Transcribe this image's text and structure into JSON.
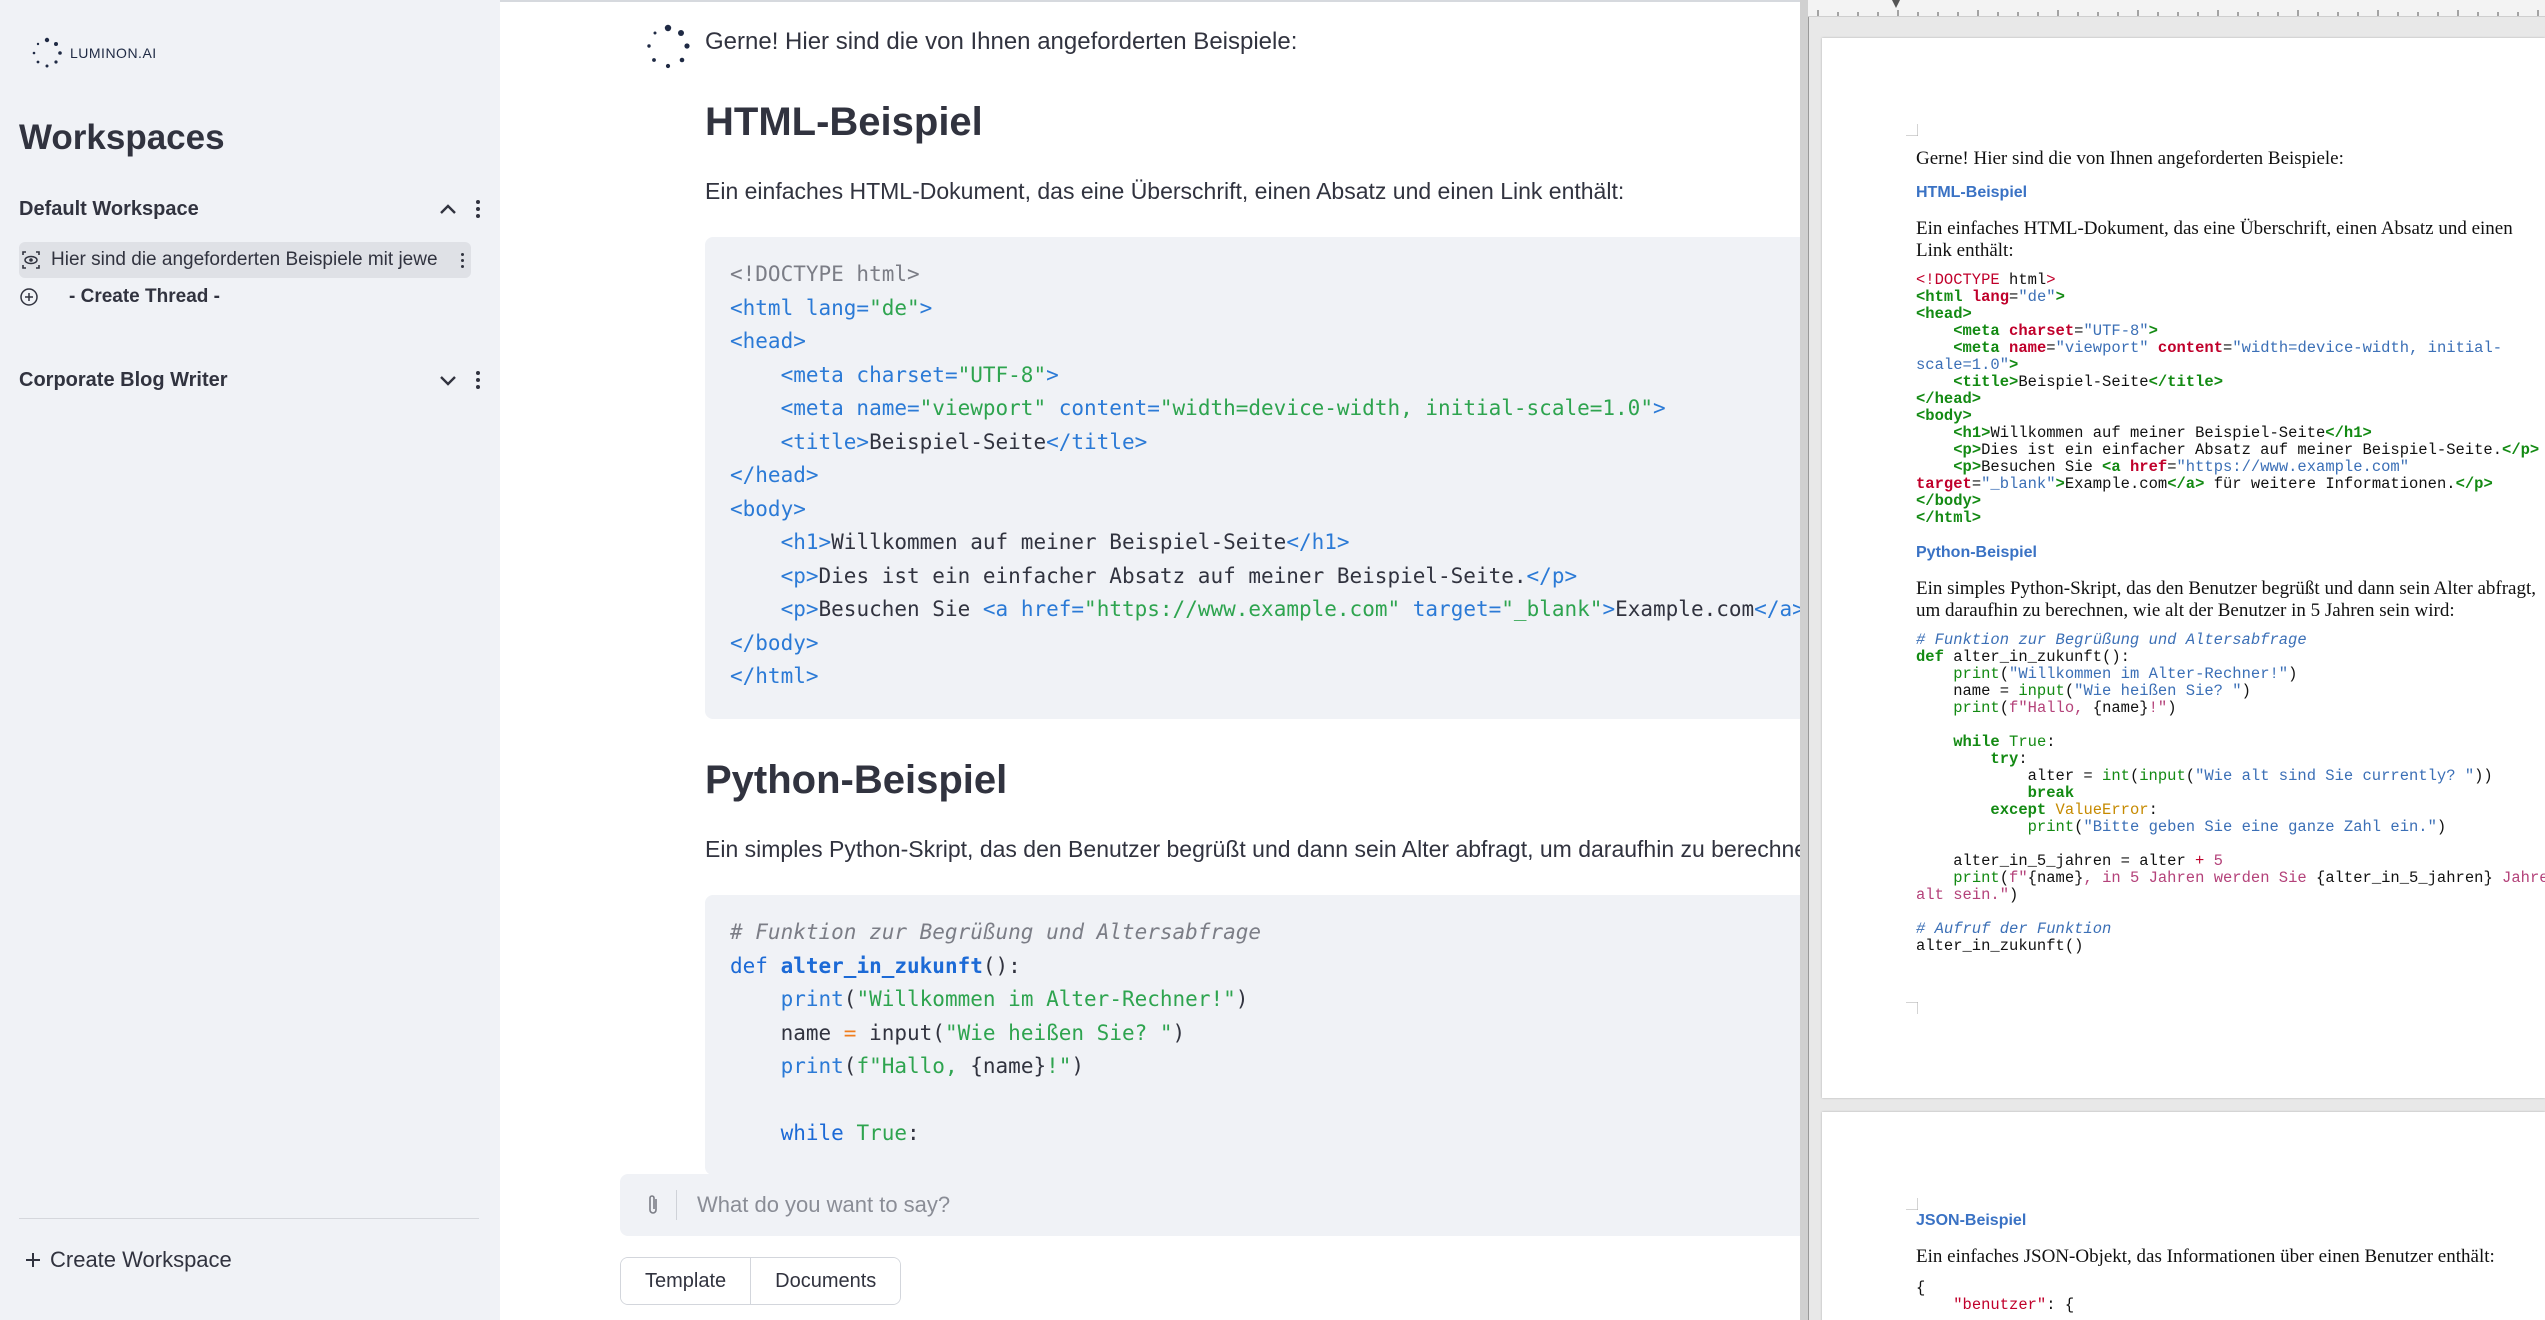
{
  "sidebar": {
    "logo_text": "LUMINON.AI",
    "title": "Workspaces",
    "workspaces": [
      {
        "name": "Default Workspace",
        "expanded": true
      },
      {
        "name": "Corporate Blog Writer",
        "expanded": false
      }
    ],
    "thread_label": "Hier sind die angeforderten Beispiele mit jewe",
    "create_thread": "- Create Thread -",
    "create_workspace": "Create Workspace"
  },
  "chat": {
    "intro": "Gerne! Hier sind die von Ihnen angeforderten Beispiele:",
    "html_heading": "HTML-Beispiel",
    "html_desc": "Ein einfaches HTML-Dokument, das eine Überschrift, einen Absatz und einen Link enthält:",
    "python_heading": "Python-Beispiel",
    "python_desc": "Ein simples Python-Skript, das den Benutzer begrüßt und dann sein Alter abfragt, um daraufhin zu berechnen,",
    "input_placeholder": "What do you want to say?",
    "tabs": [
      "Template",
      "Documents"
    ]
  },
  "document": {
    "intro": "Gerne! Hier sind die von Ihnen angeforderten Beispiele:",
    "html_heading": "HTML-Beispiel",
    "html_desc_line1": "Ein einfaches HTML-Dokument, das eine Überschrift, einen Absatz und einen",
    "html_desc_line2": "Link enthält:",
    "python_heading": "Python-Beispiel",
    "python_desc_line1": "Ein simples Python-Skript, das den Benutzer begrüßt und dann sein Alter abfragt,",
    "python_desc_line2": "um daraufhin zu berechnen, wie alt der Benutzer in 5 Jahren sein wird:",
    "json_heading": "JSON-Beispiel",
    "json_desc": "Ein einfaches JSON-Objekt, das Informationen über einen Benutzer enthält:"
  },
  "colors": {
    "sidebar_bg": "#f0f2f6",
    "code_bg": "#f0f2f6",
    "tag_blue": "#2b7ad6",
    "string_green": "#2ea44f",
    "doc_heading_blue": "#3a72c4"
  }
}
